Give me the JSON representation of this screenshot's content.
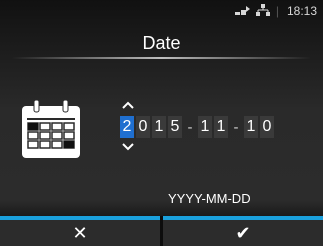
{
  "status": {
    "time": "18:13"
  },
  "header": {
    "title": "Date"
  },
  "date_editor": {
    "digits": [
      "2",
      "0",
      "1",
      "5",
      "1",
      "1",
      "1",
      "0"
    ],
    "separator": "-",
    "format_label": "YYYY-MM-DD",
    "active_digit_index": 0
  },
  "buttons": {
    "cancel_symbol": "✕",
    "ok_symbol": "✔"
  },
  "colors": {
    "accent": "#1aa0dc",
    "active_digit": "#1f6fd0"
  }
}
